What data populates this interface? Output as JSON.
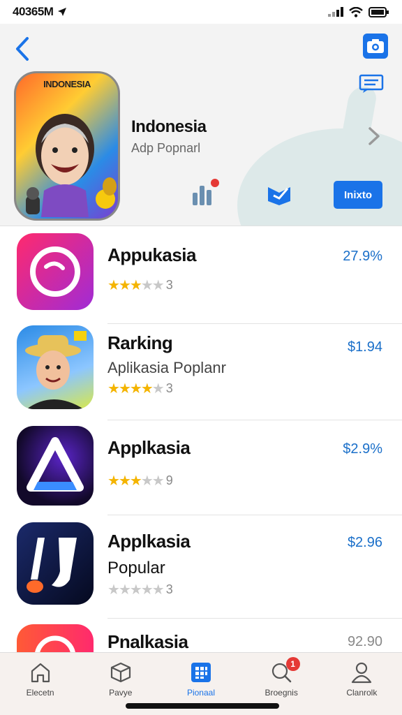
{
  "status": {
    "time": "40365M"
  },
  "header": {
    "featured_icon_text": "INDONESIA",
    "title": "Indonesia",
    "subtitle": "Adp Popnarl",
    "get_label": "Inixto"
  },
  "apps": [
    {
      "name": "Appukasia",
      "subtitle": "",
      "rating_stars": 3,
      "rating_text": "3",
      "price": "27.9%",
      "colors": [
        "#ff2a6d",
        "#a02bd6"
      ]
    },
    {
      "name": "Rarking",
      "subtitle": "Aplikasia Poplanr",
      "rating_stars": 4,
      "rating_text": "3",
      "price": "$1.94",
      "colors": [
        "#2b8be6",
        "#ffd14a"
      ]
    },
    {
      "name": "Applkasia",
      "subtitle": "",
      "rating_stars": 3,
      "rating_text": "9",
      "price": "$2.9%",
      "colors": [
        "#1a0f3a",
        "#5a24c7"
      ]
    },
    {
      "name": "Applkasia",
      "subtitle": "Popular",
      "rating_stars": 0,
      "rating_text": "3",
      "price": "$2.96",
      "colors": [
        "#0e1433",
        "#18245c"
      ]
    },
    {
      "name": "Pnalkasia",
      "subtitle": "",
      "rating_stars": 0,
      "rating_text": "",
      "price": "92.90",
      "colors": [
        "#ff5a36",
        "#ff2a6d"
      ]
    }
  ],
  "tabs": [
    {
      "label": "Elecetn",
      "icon": "home-icon",
      "active": false
    },
    {
      "label": "Pavye",
      "icon": "box-icon",
      "active": false
    },
    {
      "label": "Pionaal",
      "icon": "grid-icon",
      "active": true
    },
    {
      "label": "Broegnis",
      "icon": "search-icon",
      "active": false,
      "badge": "1"
    },
    {
      "label": "Clanrolk",
      "icon": "person-icon",
      "active": false
    }
  ],
  "colors": {
    "accent": "#1a73e8",
    "star": "#f4b400",
    "price": "#1a6fc9"
  }
}
